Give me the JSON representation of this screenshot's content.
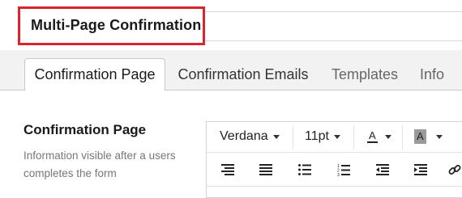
{
  "form": {
    "title": "Multi-Page Confirmation"
  },
  "tabs": [
    {
      "label": "Confirmation Page",
      "active": true
    },
    {
      "label": "Confirmation Emails",
      "active": false
    },
    {
      "label": "Templates",
      "active": false
    },
    {
      "label": "Info",
      "active": false
    }
  ],
  "section": {
    "title": "Confirmation Page",
    "description": "Information visible after a users completes the form"
  },
  "editor": {
    "font_family": "Verdana",
    "font_size": "11pt",
    "text_color_glyph": "A",
    "bg_color_glyph": "A",
    "toolbar_icons": [
      "align-left-icon",
      "align-justify-icon",
      "bullet-list-icon",
      "numbered-list-icon",
      "outdent-icon",
      "indent-icon",
      "link-icon"
    ]
  },
  "colors": {
    "highlight_border": "#d9232e",
    "tabs_background": "#f2f2f2"
  }
}
